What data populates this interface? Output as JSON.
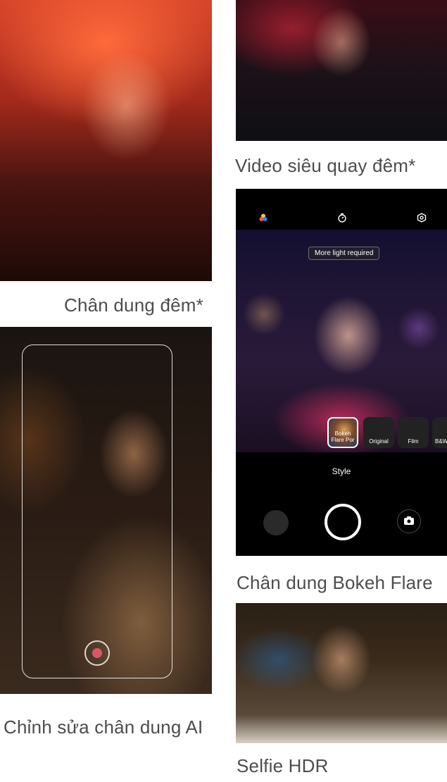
{
  "captions": {
    "night_portrait": "Chân dung đêm*",
    "super_night_video": "Video siêu quay đêm*",
    "ai_portrait_edit": "Chỉnh sửa chân dung AI",
    "bokeh_flare_portrait": "Chân dung Bokeh Flare",
    "selfie_hdr": "Selfie HDR"
  },
  "camera_ui": {
    "toast": "More light required",
    "styles": [
      {
        "label": "Bokeh Flare Por",
        "selected": true
      },
      {
        "label": "Original",
        "selected": false
      },
      {
        "label": "Film",
        "selected": false
      },
      {
        "label": "B&W",
        "selected": false
      }
    ],
    "style_label": "Style",
    "icons": {
      "color_palette": "palette-icon",
      "timer": "timer-icon",
      "settings": "settings-icon",
      "flip_camera": "flip-camera-icon"
    }
  }
}
